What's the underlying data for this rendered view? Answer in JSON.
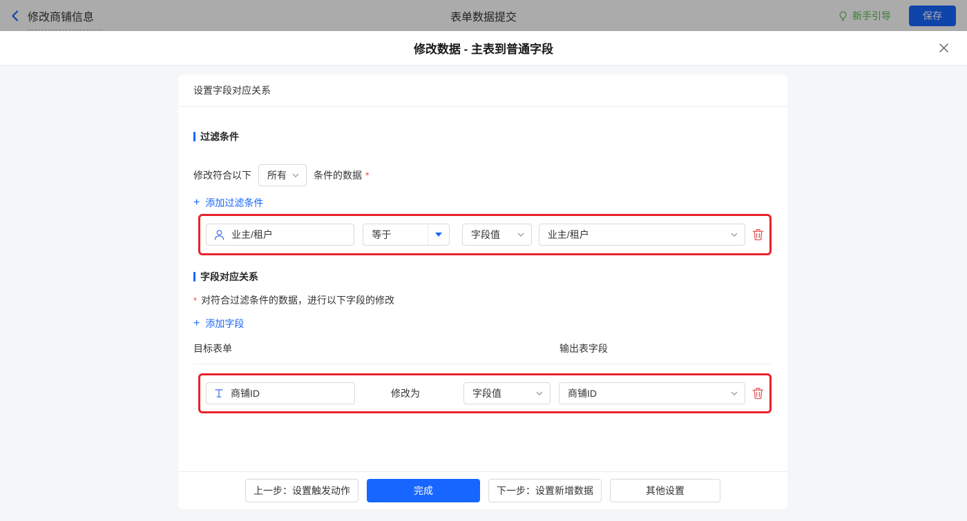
{
  "topbar": {
    "back_label": "修改商铺信息",
    "title": "表单数据提交",
    "guide_label": "新手引导",
    "save_label": "保存"
  },
  "modal": {
    "title": "修改数据 - 主表到普通字段",
    "panel_title": "设置字段对应关系",
    "filter": {
      "section_title": "过滤条件",
      "match_prefix": "修改符合以下",
      "match_value": "所有",
      "match_suffix": "条件的数据",
      "required_mark": "*",
      "add_icon": "+",
      "add_label": "添加过滤条件",
      "condition": {
        "field": "业主/租户",
        "operator": "等于",
        "value_type": "字段值",
        "value": "业主/租户"
      }
    },
    "mapping": {
      "section_title": "字段对应关系",
      "required_mark": "*",
      "description": "对符合过滤条件的数据，进行以下字段的修改",
      "add_icon": "+",
      "add_label": "添加字段",
      "columns": {
        "target": "目标表单",
        "output": "输出表字段"
      },
      "row": {
        "field": "商铺ID",
        "action_label": "修改为",
        "value_type": "字段值",
        "value": "商铺ID"
      }
    },
    "footer": {
      "prev_label": "上一步：设置触发动作",
      "done_label": "完成",
      "next_label": "下一步：设置新增数据",
      "other_label": "其他设置"
    }
  },
  "icons": {
    "back": "chevron-left-icon",
    "guide": "lightbulb-icon",
    "close": "close-icon",
    "condition_field": "person-icon",
    "mapping_field": "text-field-icon",
    "select_caret": "chevron-down-icon",
    "operator_caret": "triangle-down-icon",
    "delete": "trash-icon"
  },
  "colors": {
    "accent": "#1766ff",
    "highlight_border": "#e8222a",
    "danger_red": "#e4555a",
    "guide_green": "#55b84f",
    "required_red": "#f5483b",
    "topbar_mask": "rgba(0,0,0,0.33)"
  }
}
